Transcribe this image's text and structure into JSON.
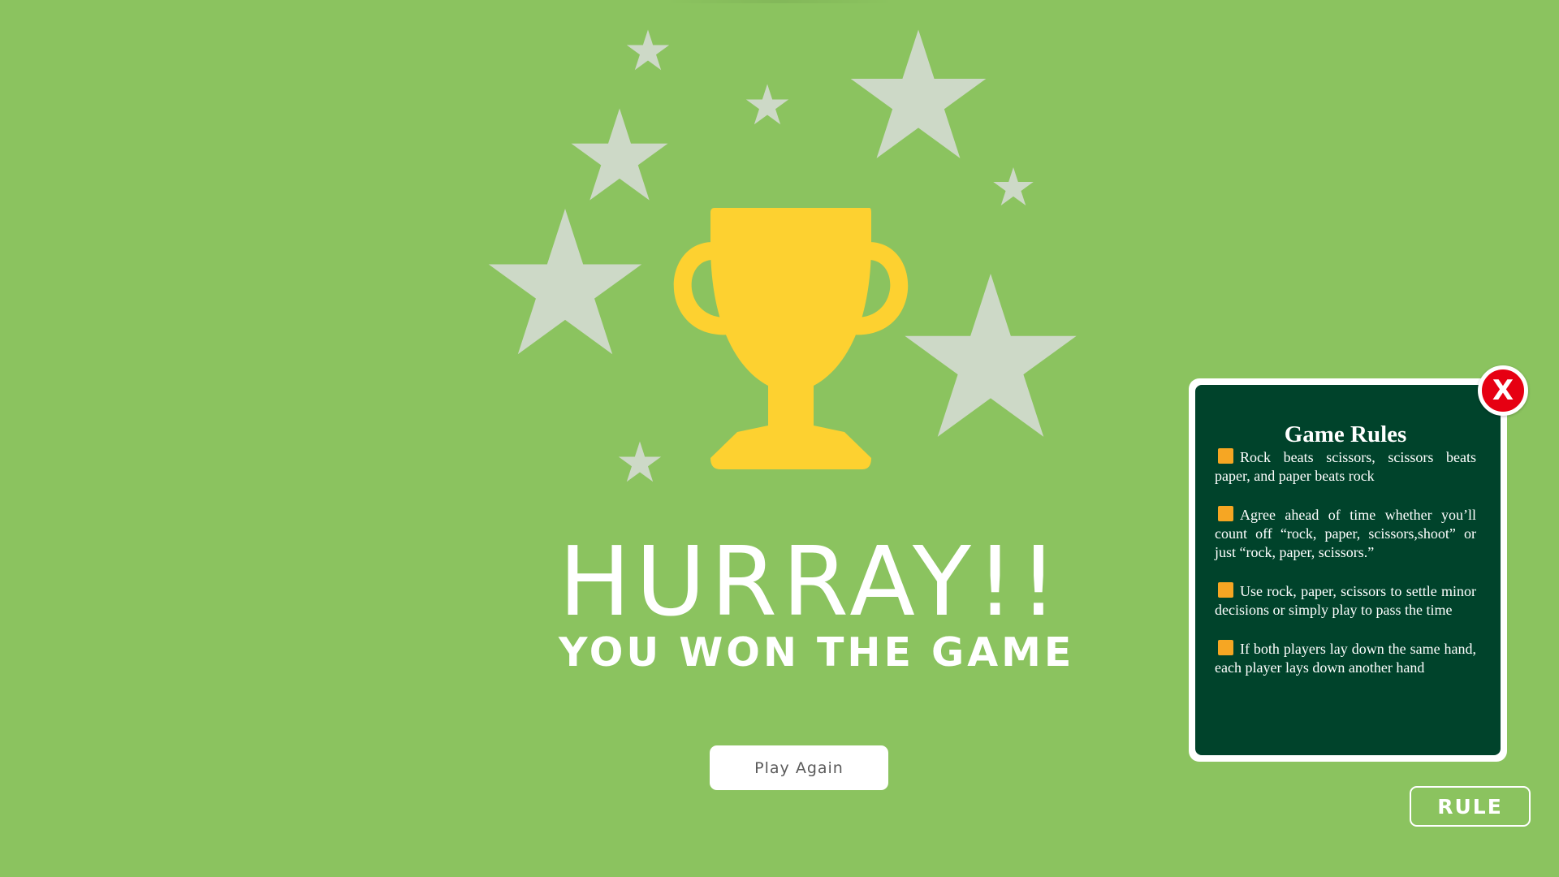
{
  "result": {
    "title": "HURRAY!!",
    "subtitle": "YOU WON THE GAME"
  },
  "actions": {
    "play_again_label": "Play Again",
    "rule_label": "RULE"
  },
  "rules_modal": {
    "title": "Game Rules",
    "close_label": "X",
    "rules": [
      "Rock beats scissors, scissors beats paper, and paper beats rock",
      "Agree ahead of time whether you’ll count off “rock, paper, scissors,shoot” or just “rock, paper, scissors.”",
      "Use rock, paper, scissors to settle minor decisions or simply play to pass the time",
      "If both players lay down the same hand, each player lays down another hand"
    ]
  },
  "icons": {
    "trophy": "trophy-icon",
    "stars": "star-icon",
    "bullet": "square-bullet-icon"
  },
  "colors": {
    "background": "#8bc35f",
    "trophy": "#fdd130",
    "stars": "#cdd9c7",
    "rules_panel": "#00432b",
    "bullet": "#f6a623",
    "close": "#e60012",
    "button_text": "#5a5a5a"
  }
}
